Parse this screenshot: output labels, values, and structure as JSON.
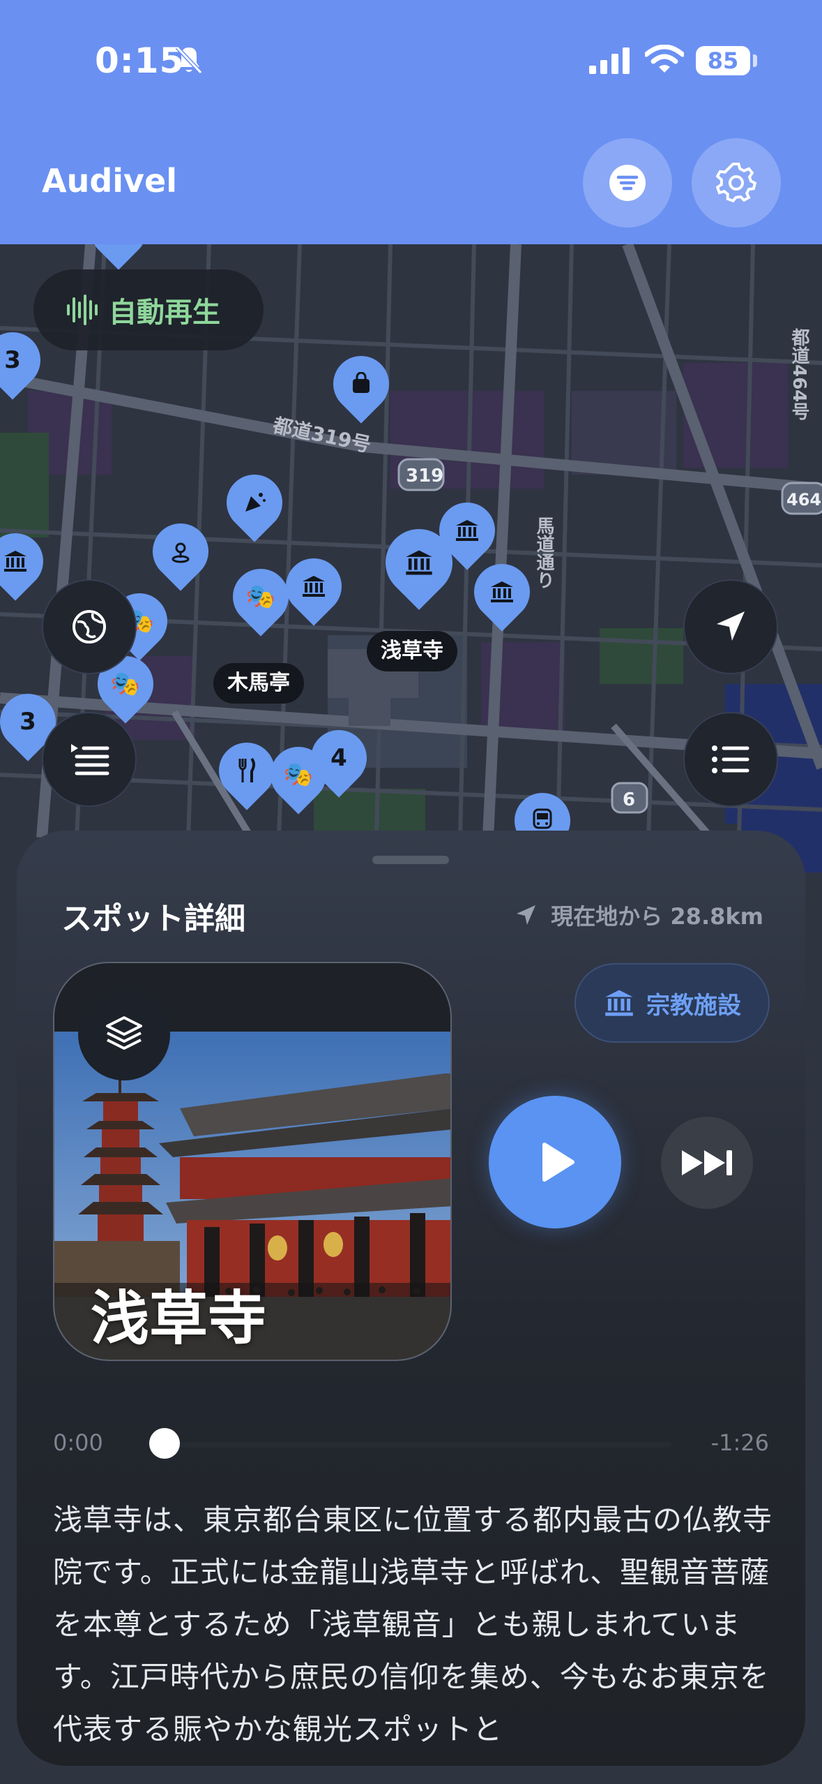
{
  "status": {
    "time": "0:15",
    "battery": "85"
  },
  "header": {
    "title": "Audivel",
    "filter_icon": "filter-icon",
    "settings_icon": "gear-icon"
  },
  "map": {
    "autoplay_label": "自動再生",
    "labels": {
      "kibatei": "木馬亭",
      "sensoji": "浅草寺"
    },
    "cluster_counts": [
      "3",
      "3",
      "4"
    ],
    "road_labels": {
      "tokyo319": "都道319号",
      "shield319": "319",
      "shield464": "464",
      "shield6": "6",
      "umamichi": "馬道通り",
      "tokyo464": "都道464号"
    },
    "colors": {
      "pin": "#6a9bf0",
      "header": "#6a90f2"
    }
  },
  "sheet": {
    "title": "スポット詳細",
    "distance": "現在地から 28.8km",
    "category": "宗教施設",
    "spot_name": "浅草寺",
    "time_elapsed": "0:00",
    "time_remaining": "-1:26",
    "progress": 0.0,
    "description": "浅草寺は、東京都台東区に位置する都内最古の仏教寺院です。正式には金龍山浅草寺と呼ばれ、聖観音菩薩を本尊とするため「浅草観音」とも親しまれています。江戸時代から庶民の信仰を集め、今もなお東京を代表する賑やかな観光スポットと"
  }
}
